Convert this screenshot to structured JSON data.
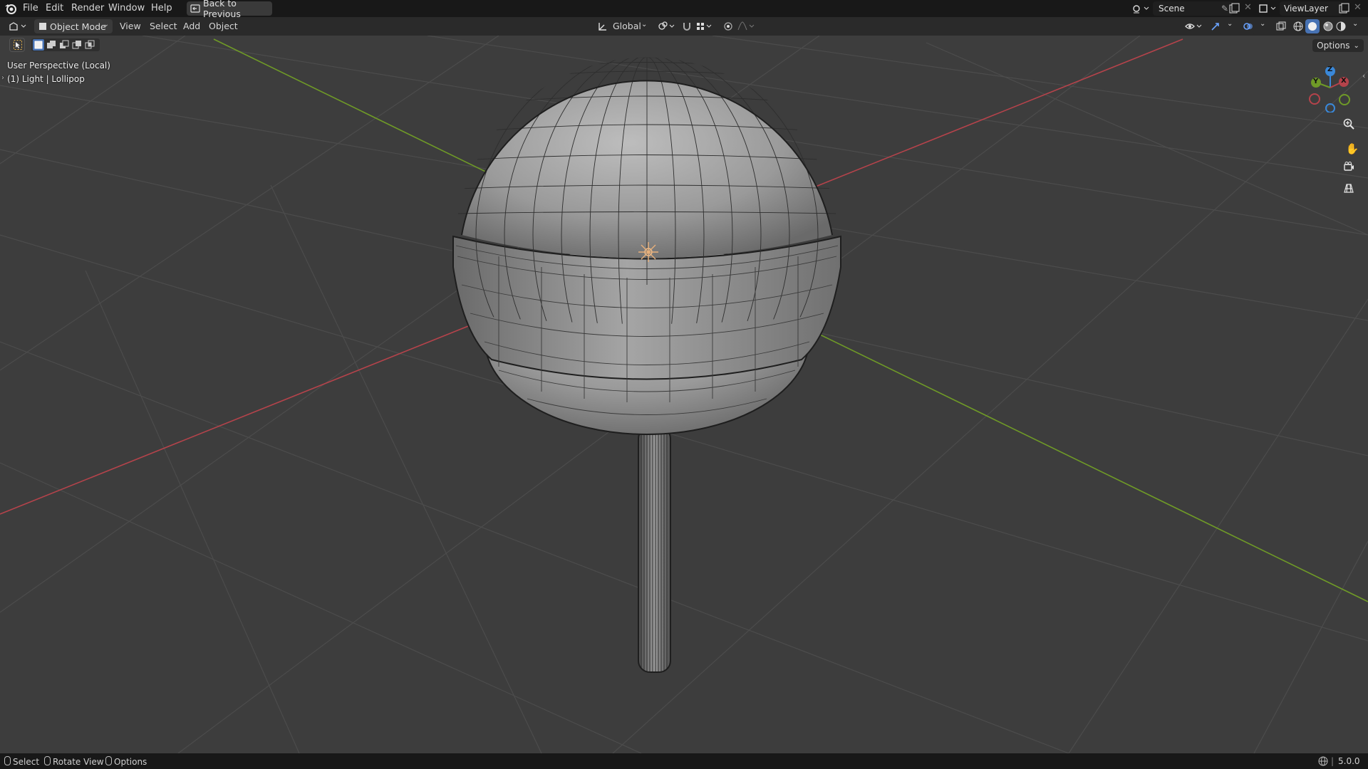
{
  "menu": {
    "items": [
      "File",
      "Edit",
      "Render",
      "Window",
      "Help"
    ],
    "back_button": "Back to Previous"
  },
  "topright": {
    "scene_label": "Scene",
    "view_layer_label": "ViewLayer"
  },
  "header": {
    "mode": "Object Mode",
    "menus": [
      "View",
      "Select",
      "Add",
      "Object"
    ],
    "transform_orientation": "Global"
  },
  "viewport": {
    "perspective_label": "User Perspective (Local)",
    "object_label": "(1) Light | Lollipop",
    "options_label": "Options",
    "gizmo": {
      "x": "X",
      "y": "Y",
      "z": "Z"
    }
  },
  "statusbar": {
    "select": "Select",
    "rotate": "Rotate View",
    "options": "Options",
    "version": "5.0.0"
  },
  "colors": {
    "x_axis": "#b5434b",
    "y_axis": "#6f9a27",
    "z_axis": "#3a88d9",
    "selection_blue": "#4772b3"
  }
}
